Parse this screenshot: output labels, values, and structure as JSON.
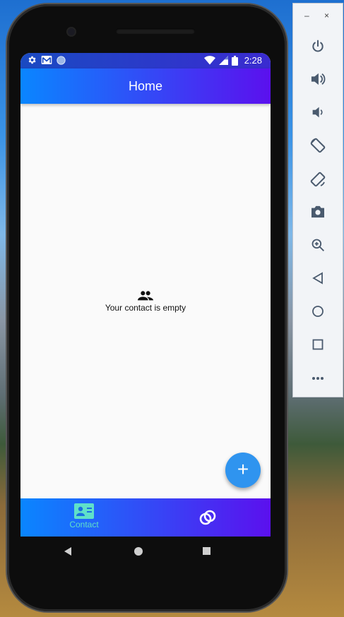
{
  "status_bar": {
    "time": "2:28",
    "icons": [
      "gear-icon",
      "mail-icon",
      "circle-icon",
      "wifi-icon",
      "signal-icon",
      "battery-icon"
    ]
  },
  "app_bar": {
    "title": "Home"
  },
  "empty_state": {
    "icon": "people-icon",
    "message": "Your contact is empty"
  },
  "fab": {
    "label": "+",
    "icon": "add-icon"
  },
  "bottom_nav": {
    "items": [
      {
        "label": "Contact",
        "icon": "contact-card-icon",
        "active": true
      },
      {
        "label": "",
        "icon": "rings-icon",
        "active": false
      }
    ]
  },
  "system_nav": {
    "buttons": [
      "back-icon",
      "home-icon",
      "recents-icon"
    ]
  },
  "emulator_toolbar": {
    "window_controls": {
      "minimize": "–",
      "close": "×"
    },
    "buttons": [
      {
        "name": "power",
        "icon": "power-icon"
      },
      {
        "name": "volume-up",
        "icon": "volume-up-icon"
      },
      {
        "name": "volume-down",
        "icon": "volume-down-icon"
      },
      {
        "name": "rotate-left",
        "icon": "rotate-left-icon"
      },
      {
        "name": "rotate-right",
        "icon": "rotate-right-icon"
      },
      {
        "name": "screenshot",
        "icon": "camera-icon"
      },
      {
        "name": "zoom",
        "icon": "zoom-icon"
      },
      {
        "name": "back",
        "icon": "back-triangle-icon"
      },
      {
        "name": "home",
        "icon": "home-circle-icon"
      },
      {
        "name": "overview",
        "icon": "overview-square-icon"
      },
      {
        "name": "more",
        "icon": "more-icon"
      }
    ]
  },
  "colors": {
    "appbar_start": "#0a86ff",
    "appbar_end": "#5b10ee",
    "fab": "#2f94ef",
    "active_nav": "#5fe0c9"
  }
}
